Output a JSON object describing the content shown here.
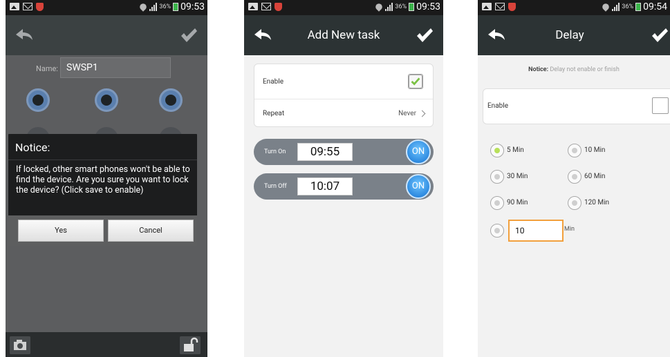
{
  "status_bar": [
    {
      "battery": "36%",
      "time": "09:53"
    },
    {
      "battery": "36%",
      "time": "09:53"
    },
    {
      "battery": "36%",
      "time": "09:54"
    }
  ],
  "screen1": {
    "name_label": "Name:",
    "name_value": "SWSP1",
    "dialog": {
      "title": "Notice:",
      "message": "If locked, other smart phones won't be able to find the device. Are you sure you want to lock the device? (Click save to enable)",
      "yes": "Yes",
      "cancel": "Cancel"
    }
  },
  "screen2": {
    "title": "Add New task",
    "enable_label": "Enable",
    "enable_checked": true,
    "repeat_label": "Repeat",
    "repeat_value": "Never",
    "turn_on_label": "Turn On",
    "turn_on_time": "09:55",
    "turn_on_state": "ON",
    "turn_off_label": "Turn Off",
    "turn_off_time": "10:07",
    "turn_off_state": "ON"
  },
  "screen3": {
    "title": "Delay",
    "notice_label": "Notice:",
    "notice_text": "Delay not enable or finish",
    "enable_label": "Enable",
    "enable_checked": false,
    "options": [
      {
        "label": "5 Min",
        "selected": true
      },
      {
        "label": "10 Min",
        "selected": false
      },
      {
        "label": "30 Min",
        "selected": false
      },
      {
        "label": "60 Min",
        "selected": false
      },
      {
        "label": "90 Min",
        "selected": false
      },
      {
        "label": "120 Min",
        "selected": false
      }
    ],
    "custom_value": "10",
    "custom_unit": "Min"
  },
  "colors": {
    "header_bg": "#2c3334",
    "check_green": "#7ac143",
    "on_button_blue": "#2f8be0",
    "custom_input_border": "#f2a03d"
  },
  "icons": [
    "back-arrow-icon",
    "checkmark-icon",
    "camera-icon",
    "unlock-icon",
    "plug-icon",
    "fan-icon",
    "bulb-icon",
    "gallery-icon",
    "mail-icon",
    "shield-icon",
    "wifi-icon",
    "signal-icon",
    "battery-icon"
  ]
}
